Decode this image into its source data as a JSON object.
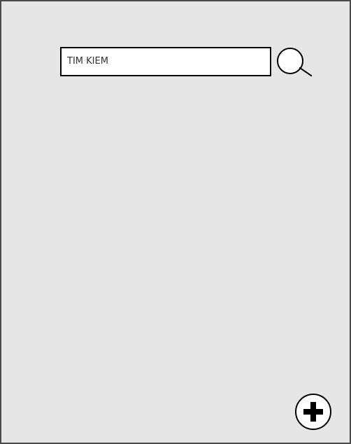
{
  "search": {
    "placeholder": "TÌM KIẾM",
    "value": "",
    "icon": "search-icon"
  },
  "add_button": {
    "icon": "plus-icon"
  },
  "colors": {
    "background": "#e6e6e6",
    "frame_border": "#4a4a4a",
    "input_border": "#000000",
    "icon_stroke": "#000000"
  }
}
